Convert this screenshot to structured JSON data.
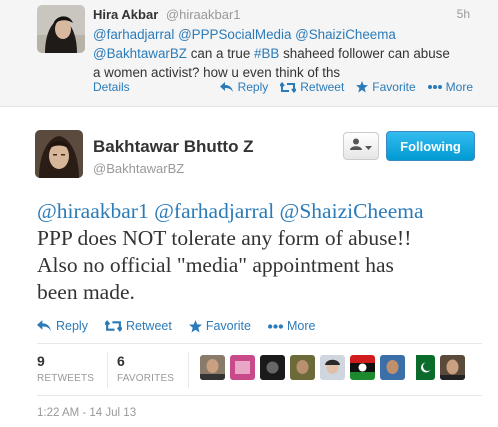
{
  "parent_tweet": {
    "name": "Hira Akbar",
    "handle": "@hiraakbar1",
    "time": "5h",
    "mentions": [
      "@farhadjarral",
      "@PPPSocialMedia",
      "@ShaiziCheema"
    ],
    "mention2": "@BakhtawarBZ",
    "text_part1": "can a true",
    "hashtag": "#BB",
    "text_part2": "shaheed follower can abuse",
    "text_line3": "a women activist? how u even think of ths",
    "details": "Details",
    "reply": "Reply",
    "retweet": "Retweet",
    "favorite": "Favorite",
    "more": "More"
  },
  "main_tweet": {
    "name": "Bakhtawar Bhutto Z",
    "handle": "@BakhtawarBZ",
    "follow_label": "Following",
    "mentions": [
      "@hiraakbar1",
      "@farhadjarral",
      "@ShaiziCheema"
    ],
    "line2": "PPP does NOT tolerate any form of abuse!!",
    "line3": "Also no official \"media\" appointment has",
    "line4": "been made.",
    "reply": "Reply",
    "retweet": "Retweet",
    "favorite": "Favorite",
    "more": "More",
    "retweets_count": "9",
    "retweets_label": "RETWEETS",
    "favorites_count": "6",
    "favorites_label": "FAVORITES",
    "timestamp": "1:22 AM - 14 Jul 13"
  },
  "colors": {
    "link": "#2b7bb9",
    "follow_button": "#019ad2",
    "muted": "#999999"
  },
  "icons": [
    "reply-icon",
    "retweet-icon",
    "star-icon",
    "more-dots-icon",
    "user-icon"
  ]
}
